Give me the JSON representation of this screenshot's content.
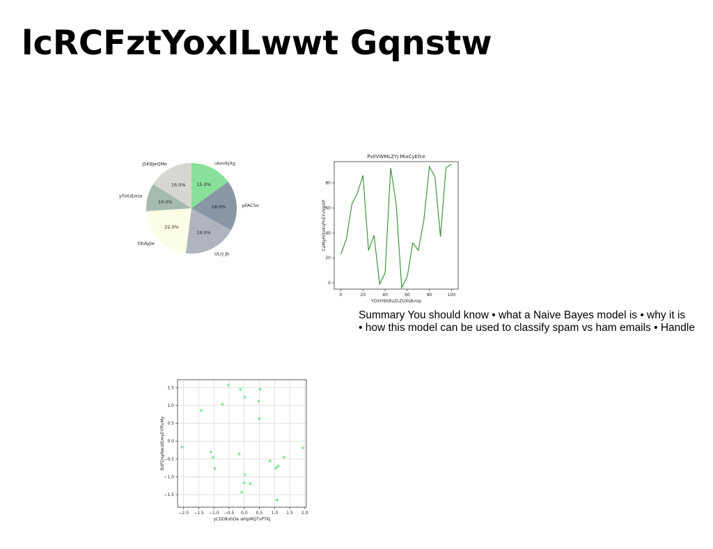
{
  "slide": {
    "title": "lcRCFztYoxILwwt Gqnstw",
    "summary_lines": [
      "Summary You should know • what a Naive Bayes model is • why it is",
      "• how this model can be used to classify spam vs ham emails • Handle"
    ]
  },
  "chart_data": [
    {
      "type": "pie",
      "title": "",
      "slices": [
        {
          "label": "ukovbjXg",
          "value": 15.0,
          "pct_label": "15.0%",
          "color": "#88e09a"
        },
        {
          "label": "pFACSo",
          "value": 18.0,
          "pct_label": "18.0%",
          "color": "#8797a4"
        },
        {
          "label": "ULrJ Jb",
          "value": 19.0,
          "pct_label": "19.0%",
          "color": "#b0b4bf"
        },
        {
          "label": "DbAyJw",
          "value": 22.0,
          "pct_label": "22.0%",
          "color": "#fbfde6"
        },
        {
          "label": "yTHUEmix",
          "value": 10.0,
          "pct_label": "10.0%",
          "color": "#a5bbb0"
        },
        {
          "label": "JSKBJeQMe",
          "value": 16.0,
          "pct_label": "16.0%",
          "color": "#d7d6d0"
        }
      ],
      "start_angle_deg": 90,
      "direction": "clockwise"
    },
    {
      "type": "line",
      "title": "PvIlVWMLZYj MixCyEfce",
      "xlabel": "YDXIYBSRzZLZUXsBvUp",
      "ylabel": "CaMgHIXxKqPnEYvSIpXP",
      "xlim": [
        -6,
        106
      ],
      "ylim": [
        -5,
        97
      ],
      "xticks": [
        0,
        20,
        40,
        60,
        80,
        100
      ],
      "yticks": [
        0,
        20,
        40,
        60,
        80
      ],
      "grid": false,
      "color": "#2e8b2e",
      "series": [
        {
          "x": [
            0,
            5,
            10,
            15,
            20,
            25,
            30,
            35,
            40,
            45,
            50,
            55,
            60,
            65,
            70,
            75,
            80,
            85,
            90,
            95,
            100
          ],
          "values": [
            23,
            35,
            63,
            72,
            86,
            26,
            38,
            -1,
            8,
            92,
            63,
            -4,
            5,
            32,
            26,
            50,
            93,
            85,
            37,
            92,
            95
          ]
        }
      ]
    },
    {
      "type": "scatter",
      "title": "",
      "xlabel": "yCDDKxhDe wHpMQTvPTKJ",
      "ylabel": "BdPDxpNwatEmyEYPluMy",
      "xlim": [
        -2.2,
        2.05
      ],
      "ylim": [
        -1.85,
        1.72
      ],
      "xticks": [
        -2.0,
        -1.5,
        -1.0,
        -0.5,
        0.0,
        0.5,
        1.0,
        1.5,
        2.0
      ],
      "xtick_labels": [
        "−2.0",
        "−1.5",
        "−1.0",
        "−0.5",
        "0.0",
        "0.5",
        "1.0",
        "1.5",
        "2.0"
      ],
      "yticks": [
        -1.5,
        -1.0,
        -0.5,
        0.0,
        0.5,
        1.0,
        1.5
      ],
      "ytick_labels": [
        "−1.5",
        "−1.0",
        "−0.5",
        "0.0",
        "0.5",
        "1.0",
        "1.5"
      ],
      "grid": true,
      "color": "#8ee8a8",
      "points": [
        {
          "x": -2.05,
          "y": -0.17
        },
        {
          "x": -1.42,
          "y": 0.86
        },
        {
          "x": -1.1,
          "y": -0.31
        },
        {
          "x": -1.03,
          "y": -0.46
        },
        {
          "x": -0.97,
          "y": -0.77
        },
        {
          "x": -0.72,
          "y": 1.03
        },
        {
          "x": -0.52,
          "y": 1.57
        },
        {
          "x": -0.17,
          "y": -0.36
        },
        {
          "x": -0.12,
          "y": 1.45
        },
        {
          "x": -0.08,
          "y": -1.43
        },
        {
          "x": 0.0,
          "y": -1.17
        },
        {
          "x": 0.02,
          "y": 1.23
        },
        {
          "x": 0.02,
          "y": -0.94
        },
        {
          "x": 0.2,
          "y": -1.19
        },
        {
          "x": 0.48,
          "y": 1.12
        },
        {
          "x": 0.5,
          "y": 0.63
        },
        {
          "x": 0.52,
          "y": 1.45
        },
        {
          "x": 0.85,
          "y": -0.55
        },
        {
          "x": 1.05,
          "y": -0.75
        },
        {
          "x": 1.08,
          "y": -1.65
        },
        {
          "x": 1.12,
          "y": -0.7
        },
        {
          "x": 1.31,
          "y": -0.45
        },
        {
          "x": 1.93,
          "y": -0.19
        }
      ]
    }
  ]
}
